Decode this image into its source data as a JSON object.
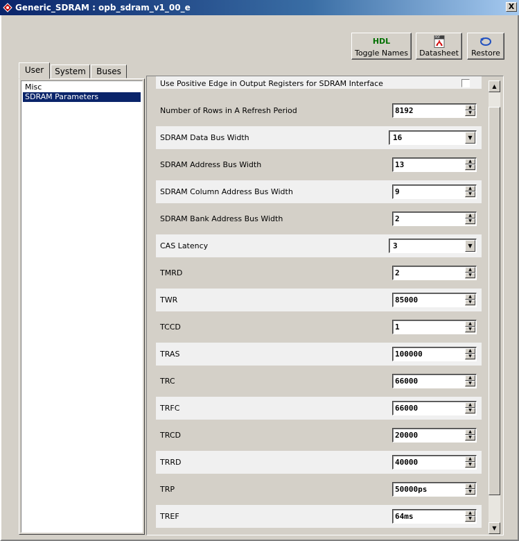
{
  "window": {
    "title": "Generic_SDRAM : opb_sdram_v1_00_e",
    "close_label": "X"
  },
  "toolbar": {
    "toggle_names": {
      "icon_text": "HDL",
      "label": "Toggle Names"
    },
    "datasheet": {
      "icon_text": "PDF",
      "label": "Datasheet"
    },
    "restore": {
      "label": "Restore"
    }
  },
  "tabs": [
    {
      "label": "User",
      "active": true
    },
    {
      "label": "System",
      "active": false
    },
    {
      "label": "Buses",
      "active": false
    }
  ],
  "categories": [
    {
      "label": "Misc",
      "selected": false
    },
    {
      "label": "SDRAM Parameters",
      "selected": true
    }
  ],
  "params": [
    {
      "label": "Use Positive Edge in Output Registers for SDRAM Interface",
      "control": "checkbox",
      "checked": false
    },
    {
      "label": "Number of Rows in A Refresh Period",
      "control": "spin",
      "value": "8192"
    },
    {
      "label": "SDRAM Data Bus Width",
      "control": "combo",
      "value": "16"
    },
    {
      "label": "SDRAM Address Bus Width",
      "control": "spin",
      "value": "13"
    },
    {
      "label": "SDRAM Column Address Bus Width",
      "control": "spin",
      "value": "9"
    },
    {
      "label": "SDRAM Bank Address Bus Width",
      "control": "spin",
      "value": "2"
    },
    {
      "label": "CAS Latency",
      "control": "combo",
      "value": "3"
    },
    {
      "label": "TMRD",
      "control": "spin",
      "value": "2"
    },
    {
      "label": "TWR",
      "control": "spin",
      "value": "85000"
    },
    {
      "label": "TCCD",
      "control": "spin",
      "value": "1"
    },
    {
      "label": "TRAS",
      "control": "spin",
      "value": "100000"
    },
    {
      "label": "TRC",
      "control": "spin",
      "value": "66000"
    },
    {
      "label": "TRFC",
      "control": "spin",
      "value": "66000"
    },
    {
      "label": "TRCD",
      "control": "spin",
      "value": "20000"
    },
    {
      "label": "TRRD",
      "control": "spin",
      "value": "40000"
    },
    {
      "label": "TRP",
      "control": "spin",
      "value": "50000ps"
    },
    {
      "label": "TREF",
      "control": "spin",
      "value": "64ms"
    }
  ]
}
